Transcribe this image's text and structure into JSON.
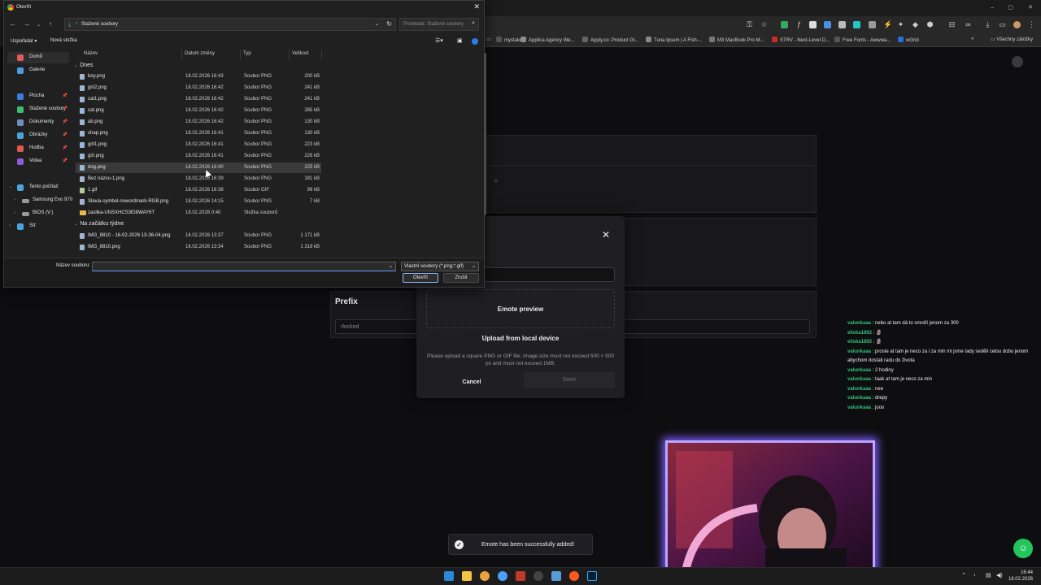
{
  "bookmarks": [
    {
      "label": "mystake",
      "color": "#555555"
    },
    {
      "label": "Applica Agency We...",
      "color": "#8c8c8c"
    },
    {
      "label": "Apply.co: Product Gr...",
      "color": "#666666"
    },
    {
      "label": "Tuna Ipsum | A Fish-...",
      "color": "#888888"
    },
    {
      "label": "M3 MacBook Pro M...",
      "color": "#777777"
    },
    {
      "label": "STRV - Next-Level D...",
      "color": "#cc2a2a"
    },
    {
      "label": "Free Fonts - Awwwa...",
      "color": "#555555"
    },
    {
      "label": "wGrid",
      "color": "#2d6cdf"
    }
  ],
  "all_bookmarks": "Všechny záložky",
  "page": {
    "prefix_label": "Prefix",
    "prefix_value": "rlocked"
  },
  "modal": {
    "close": "✕",
    "preview": "Emote preview",
    "upload": "Upload from local device",
    "hint": "Please upload a square PNG or GIF file. Image size must not exceed 500 × 500 px and must not exceed 1MB.",
    "cancel": "Cancel",
    "save": "Save"
  },
  "chat": [
    {
      "user": "valunkaaa",
      "msg": ": nebo at tam dá to smrdíí jenom za 300"
    },
    {
      "user": "eliska1892",
      "msg": ": 🗿"
    },
    {
      "user": "eliska1892",
      "msg": ": 🗿"
    },
    {
      "user": "valunkaaa",
      "msg": ": proste at tam je neco za i za min mi jsme tady seděli celou dobu jenom"
    },
    {
      "user": "",
      "msg": "abychom dostali radu do života"
    },
    {
      "user": "valunkaaa",
      "msg": ": 2 hodiny"
    },
    {
      "user": "valunkaaa",
      "msg": ": taak at tam je neco za min"
    },
    {
      "user": "valunkaaa",
      "msg": ": nee"
    },
    {
      "user": "valunkaaa",
      "msg": ": drepy"
    },
    {
      "user": "valunkaaa",
      "msg": ": jooo"
    }
  ],
  "toast": "Emote has been successfully added!",
  "taskbar": {
    "apps": [
      "#2b88d8",
      "#f4c542",
      "#e8a33d",
      "#4aa0ff",
      "#c0392b",
      "#d35400",
      "#5a9bd5",
      "#ff5722",
      "#31a8ff"
    ],
    "time": "16:44",
    "date": "18.02.2026"
  },
  "dialog": {
    "title": "Otevřít",
    "path": "Stažené soubory",
    "search_placeholder": "Prohledat: Stažené soubory",
    "organize": "Uspořádat",
    "new_folder": "Nová složka",
    "columns": {
      "name": "Název",
      "date": "Datum změny",
      "type": "Typ",
      "size": "Velikost"
    },
    "sidebar": [
      {
        "label": "Domů",
        "color": "#e05a5a",
        "pin": false,
        "selected": true
      },
      {
        "label": "Galerie",
        "color": "#4a9be0",
        "pin": false
      },
      {
        "label": "Plocha",
        "color": "#3b7ddd",
        "pin": true
      },
      {
        "label": "Stažené soubory",
        "color": "#3dbb6f",
        "pin": true
      },
      {
        "label": "Dokumenty",
        "color": "#6c8fbf",
        "pin": true
      },
      {
        "label": "Obrázky",
        "color": "#4aa3df",
        "pin": true
      },
      {
        "label": "Hudba",
        "color": "#e0584a",
        "pin": true
      },
      {
        "label": "Videa",
        "color": "#8e5bd6",
        "pin": true
      },
      {
        "label": "Tento počítač",
        "color": "#4aa3df",
        "pin": false
      },
      {
        "label": "Samsung Evo 970",
        "color": "#9a9a9a",
        "pin": false
      },
      {
        "label": "BIOS (V:)",
        "color": "#9a9a9a",
        "pin": false
      },
      {
        "label": "Síť",
        "color": "#4aa3df",
        "pin": false
      }
    ],
    "group_today": "Dnes",
    "group_week": "Na začátku týdne",
    "files_today": [
      {
        "name": "boy.png",
        "date": "18.02.2026 16:43",
        "type": "Soubor PNG",
        "size": "200 kB"
      },
      {
        "name": "girl2.png",
        "date": "18.02.2026 16:42",
        "type": "Soubor PNG",
        "size": "241 kB"
      },
      {
        "name": "cat1.png",
        "date": "18.02.2026 16:42",
        "type": "Soubor PNG",
        "size": "241 kB"
      },
      {
        "name": "cat.png",
        "date": "18.02.2026 16:42",
        "type": "Soubor PNG",
        "size": "285 kB"
      },
      {
        "name": "ab.png",
        "date": "18.02.2026 16:42",
        "type": "Soubor PNG",
        "size": "130 kB"
      },
      {
        "name": "shap.png",
        "date": "18.02.2026 16:41",
        "type": "Soubor PNG",
        "size": "130 kB"
      },
      {
        "name": "girl1.png",
        "date": "18.02.2026 16:41",
        "type": "Soubor PNG",
        "size": "223 kB"
      },
      {
        "name": "girl.png",
        "date": "18.02.2026 16:41",
        "type": "Soubor PNG",
        "size": "226 kB"
      },
      {
        "name": "dog.png",
        "date": "18.02.2026 16:40",
        "type": "Soubor PNG",
        "size": "225 kB"
      },
      {
        "name": "Bez názvu-1.png",
        "date": "18.02.2026 16:39",
        "type": "Soubor PNG",
        "size": "181 kB"
      },
      {
        "name": "1.gif",
        "date": "18.02.2026 16:38",
        "type": "Soubor GIF",
        "size": "99 kB"
      },
      {
        "name": "Slavia-symbol-nowordmark-RGB.png",
        "date": "18.02.2026 14:15",
        "type": "Soubor PNG",
        "size": "7 kB"
      },
      {
        "name": "zasilka-UNSXHCS3EI8WAY6T",
        "date": "18.02.2026 0:40",
        "type": "Složka souborů",
        "size": ""
      }
    ],
    "files_week": [
      {
        "name": "IMG_8810 - 16-02-2026 13-36-04.png",
        "date": "16.02.2026 13:37",
        "type": "Soubor PNG",
        "size": "1 171 kB"
      },
      {
        "name": "IMG_8810.png",
        "date": "16.02.2026 13:34",
        "type": "Soubor PNG",
        "size": "1 318 kB"
      }
    ],
    "filename_label": "Název souboru:",
    "filetype": "Vlastní soubory (*.png;*.gif)",
    "open": "Otevřít",
    "cancel": "Zrušit"
  }
}
